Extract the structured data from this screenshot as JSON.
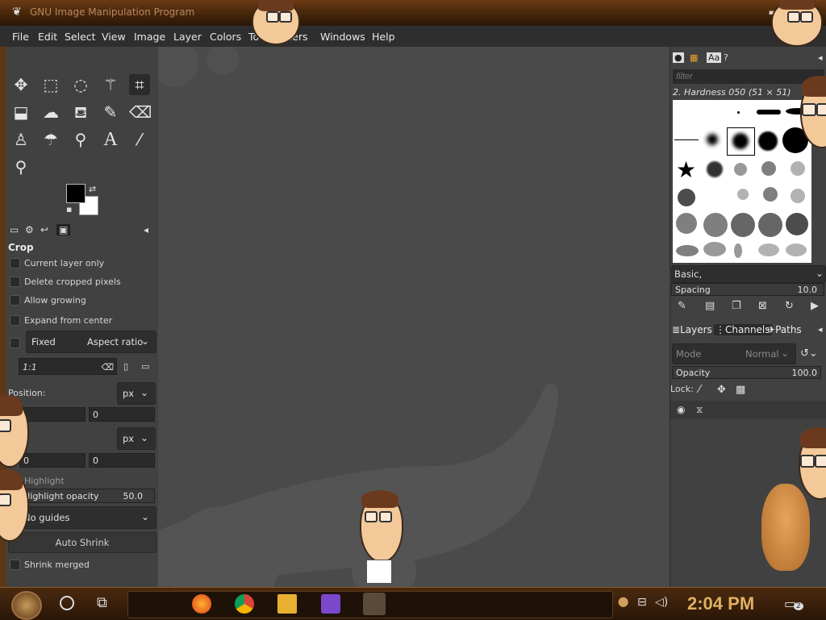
{
  "window": {
    "title": "GNU Image Manipulation Program"
  },
  "menu": [
    "File",
    "Edit",
    "Select",
    "View",
    "Image",
    "Layer",
    "Colors",
    "Tools",
    "Filters",
    "Windows",
    "Help"
  ],
  "tool_options": {
    "title": "Crop",
    "current_layer_only": "Current layer only",
    "delete_cropped": "Delete cropped pixels",
    "allow_growing": "Allow growing",
    "expand_center": "Expand from center",
    "fixed": "Fixed",
    "aspect_ratio": "Aspect ratio",
    "ratio_value": "1:1",
    "position_label": "Position:",
    "position_unit": "px",
    "position_x": "0",
    "position_y": "0",
    "size_unit": "px",
    "size_x": "0",
    "size_y": "0",
    "highlight": "Highlight",
    "highlight_opacity_label": "Highlight opacity",
    "highlight_opacity_value": "50.0",
    "guides": "No guides",
    "auto_shrink": "Auto Shrink",
    "shrink_merged": "Shrink merged"
  },
  "brushes": {
    "filter_placeholder": "filter",
    "selected": "2. Hardness 050 (51 × 51)",
    "tag": "Basic,",
    "spacing_label": "Spacing",
    "spacing_value": "10.0"
  },
  "layers": {
    "tabs": [
      "Layers",
      "Channels",
      "Paths"
    ],
    "mode_label": "Mode",
    "mode_value": "Normal",
    "opacity_label": "Opacity",
    "opacity_value": "100.0",
    "lock_label": "Lock:"
  },
  "taskbar": {
    "time": "2:04 PM",
    "notification_count": "2"
  },
  "colors": {
    "fg": "#000000",
    "bg": "#ffffff",
    "accent": "#e0b060"
  }
}
